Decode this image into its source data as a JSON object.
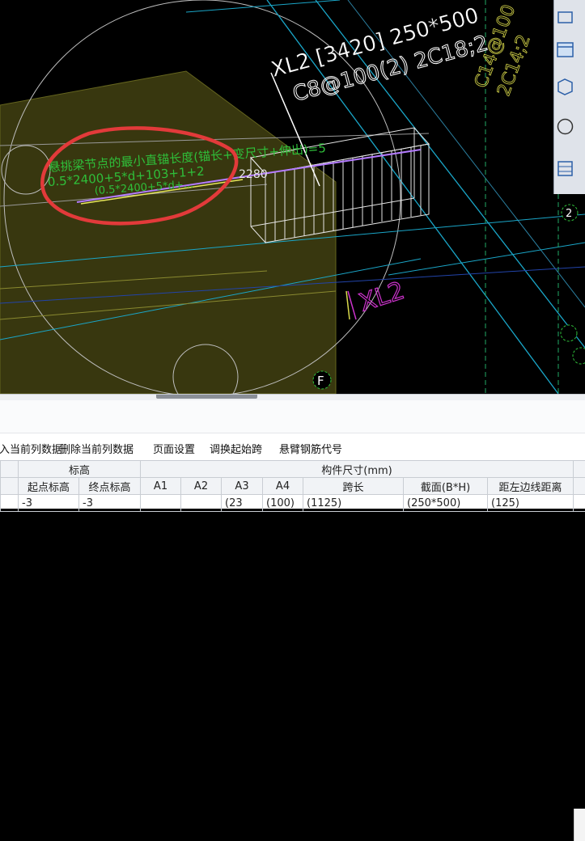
{
  "cad": {
    "beam_label_line1": "XL2 [3420] 250*500",
    "beam_label_line2": "C8@100(2) 2C18;2",
    "annot_title": "悬挑梁节点的最小直锚长度(锚长+变尺寸+伸出)=5",
    "annot_formula1": "0.5*2400+5*d+103+1+2",
    "annot_formula2": "(0.5*2400+5*d+...",
    "dim_value": "2280",
    "beam_name_magenta": "XL2",
    "axis_label_f": "F",
    "axis_label_2": "2",
    "colors": {
      "background": "#000000",
      "slab_fill": "#3b3a10",
      "annotation_green": "#2fbf3a",
      "label_white": "#ffffff",
      "magenta": "#cc33cc",
      "cyan": "#1aa6c8",
      "yellow_text": "#d8d84a",
      "red_markup": "#e23a3a"
    }
  },
  "toolbar": {
    "icons": [
      "rectangle-icon",
      "window-icon",
      "cube-icon",
      "circle-icon",
      "grid-icon"
    ]
  },
  "menu": {
    "item1": "插入当前列数据",
    "item2": "删除当前列数据",
    "item3": "页面设置",
    "item4": "调换起始跨",
    "item5": "悬臂钢筋代号"
  },
  "table": {
    "group_elevation": "标高",
    "group_size": "构件尺寸(mm)",
    "headers": [
      "起点标高",
      "终点标高",
      "A1",
      "A2",
      "A3",
      "A4",
      "跨长",
      "截面(B*H)",
      "距左边线距离"
    ],
    "row1": [
      "-3",
      "-3",
      "",
      "",
      "(23",
      "(100)",
      "(1125)",
      "(250*500)",
      "(125)"
    ]
  }
}
